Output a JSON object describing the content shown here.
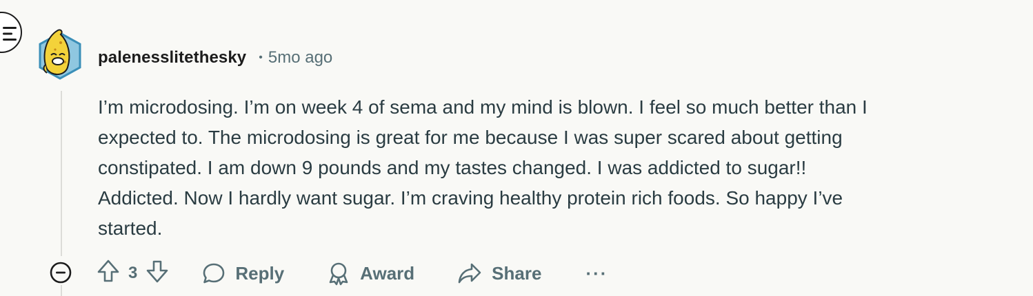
{
  "comment": {
    "username": "palenesslitethesky",
    "separator": "•",
    "timestamp": "5mo ago",
    "body_lines": [
      "I’m microdosing. I’m on week 4 of sema and my mind is blown. I feel so much better than I",
      "expected to. The microdosing is great for me because I was super scared about getting",
      "constipated. I am down 9 pounds and my tastes changed. I was addicted to sugar!!",
      "Addicted. Now I hardly want sugar. I’m craving healthy protein rich foods. So happy I’ve",
      "started."
    ],
    "vote_count": "3"
  },
  "actions": {
    "reply_label": "Reply",
    "award_label": "Award",
    "share_label": "Share",
    "more_label": "···"
  },
  "icons": {
    "menu": "menu-icon",
    "avatar": "avatar-icon",
    "collapse": "collapse-icon",
    "upvote": "upvote-icon",
    "downvote": "downvote-icon",
    "reply": "reply-icon",
    "award": "award-icon",
    "share": "share-icon"
  },
  "colors": {
    "background": "#f9f9f6",
    "meta_text": "#576f76",
    "body_text": "#2a3c42"
  }
}
